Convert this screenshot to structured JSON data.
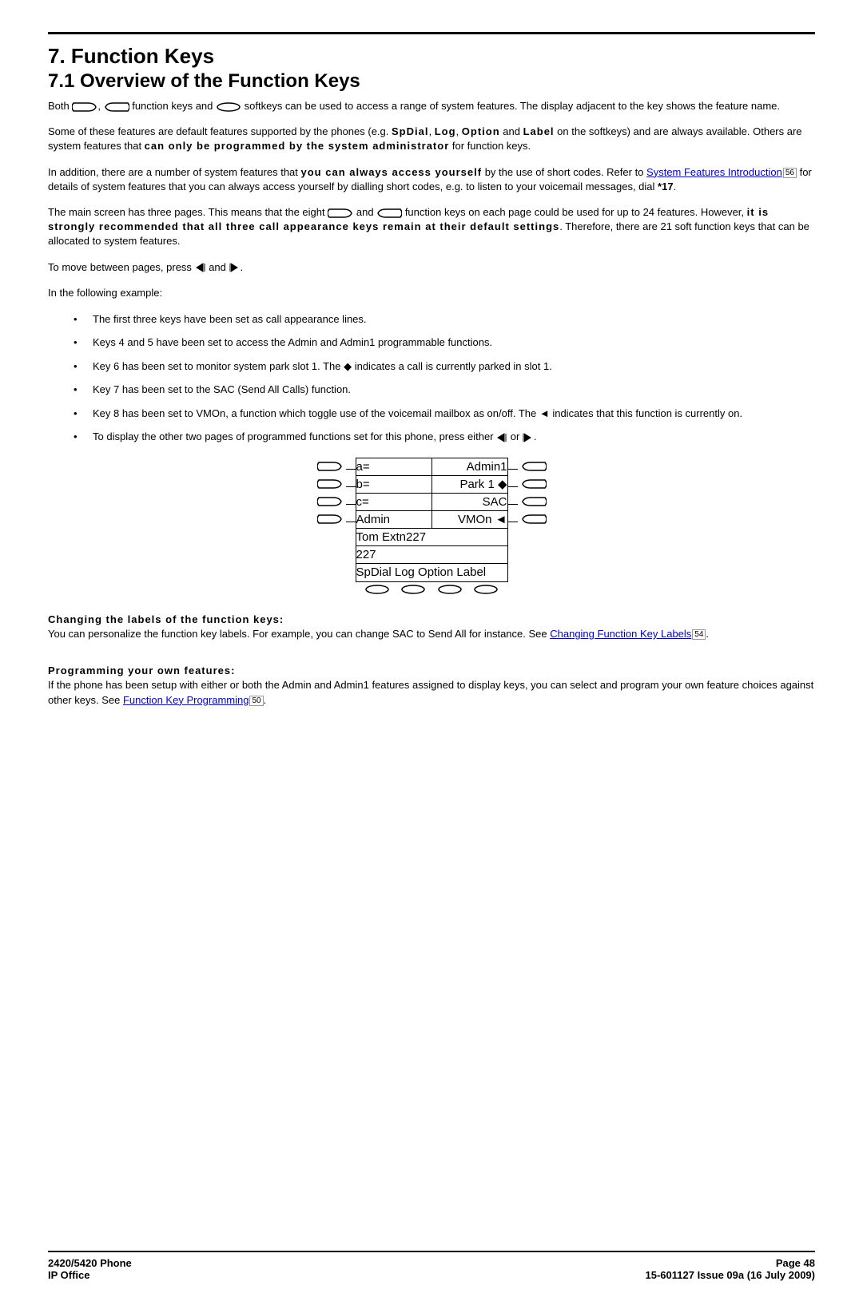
{
  "heading": "7. Function Keys",
  "subheading": "7.1 Overview of the Function Keys",
  "p1a": "Both ",
  "p1b": ", ",
  "p1c": " function keys and ",
  "p1d": " softkeys can be used to access a range of system features. The display adjacent to the key shows the feature name.",
  "p2a": "Some of these features are default features supported by the phones (e.g. ",
  "p2_sp": "SpDial",
  "p2b": ", ",
  "p2_log": "Log",
  "p2c": ", ",
  "p2_opt": "Option",
  "p2d": " and ",
  "p2_lbl": "Label",
  "p2e": " on the softkeys) and are always available. Others are system features that ",
  "p2_can": "can only be programmed by the system administrator",
  "p2f": " for function keys.",
  "p3a": "In addition, there are a number of system features that ",
  "p3_you": "you can always access yourself",
  "p3b": " by the use of short codes. Refer to ",
  "link1": "System Features Introduction",
  "ref1": "56",
  "p3c": " for details of system features that you can always access yourself by dialling short codes, e.g. to listen to your voicemail messages, dial ",
  "p3_code": "*17",
  "p3d": ".",
  "p4a": "The main screen has three pages. This means that the eight ",
  "p4b": " and ",
  "p4c": " function keys on each page could be used for up to 24 features. However, ",
  "p4_strong": "it is strongly recommended that all three call appearance keys remain at their default settings",
  "p4d": ". Therefore, there are 21 soft function keys that can be allocated to system features.",
  "p5a": "To move between pages, press ",
  "p5b": " and ",
  "p5c": ".",
  "p6": "In the following example:",
  "b1": "The first three keys have been set as call appearance lines.",
  "b2": "Keys 4 and 5 have been set to access the Admin and Admin1 programmable functions.",
  "b3a": "Key 6 has been set to monitor system park slot 1. The ",
  "b3b": " indicates a call is currently parked in slot 1.",
  "b4": "Key 7 has been set to the SAC (Send All Calls) function.",
  "b5a": "Key 8 has been set to VMOn, a function which toggle use of the voicemail mailbox as on/off. The ",
  "b5b": " indicates that this function is currently on.",
  "b6a": "To display the other two pages of programmed functions set for this phone, press either ",
  "b6b": " or ",
  "b6c": ".",
  "disp": {
    "r1l": "a=",
    "r1r": "Admin1",
    "r2l": "b=",
    "r2r": "Park 1 ◆",
    "r3l": "c=",
    "r3r": "SAC",
    "r4l": "Admin",
    "r4r": "VMOn ◄",
    "r5": "Tom Extn227",
    "r6": "227",
    "sk": "SpDial  Log    Option  Label"
  },
  "sec1_title": "Changing the labels of the function keys:",
  "sec1a": "You can personalize the function key labels. For example, you can change SAC to Send All for instance. See ",
  "link2": "Changing Function Key Labels",
  "ref2": "54",
  "sec1b": ".",
  "sec2_title": "Programming your own features:",
  "sec2a": "If the phone has been setup with either or both the Admin and Admin1 features assigned to display keys, you can select and program your own feature choices against other keys. See ",
  "link3": "Function Key Programming",
  "ref3": "50",
  "sec2b": ".",
  "footer": {
    "left1": "2420/5420 Phone",
    "left2": "IP Office",
    "right1": "Page 48",
    "right2": "15-601127 Issue 09a (16 July 2009)"
  }
}
